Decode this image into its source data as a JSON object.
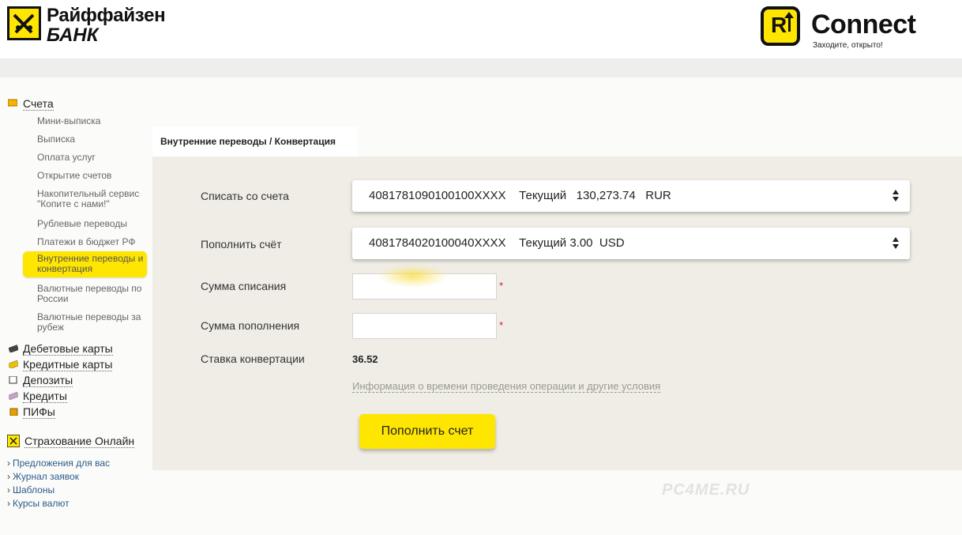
{
  "header": {
    "bank_logo_line1": "Райффайзен",
    "bank_logo_line2": "БАНК",
    "connect_letter": "R",
    "connect_title": "Connect",
    "connect_subtitle": "Заходите, открыто!"
  },
  "sidebar": {
    "accounts_title": "Счета",
    "account_items": [
      "Мини-выписка",
      "Выписка",
      "Оплата услуг",
      "Открытие счетов",
      "Накопительный сервис \"Копите с нами!\"",
      "Рублевые переводы",
      "Платежи в бюджет РФ",
      "Внутренние переводы и конвертация",
      "Валютные переводы по России",
      "Валютные переводы за рубеж"
    ],
    "products": [
      "Дебетовые карты",
      "Кредитные карты",
      "Депозиты",
      "Кредиты",
      "ПИФы"
    ],
    "insurance": "Страхование Онлайн",
    "links": [
      "Предложения для вас",
      "Журнал заявок",
      "Шаблоны",
      "Курсы валют"
    ]
  },
  "main": {
    "tab_label": "Внутренние переводы / Конвертация",
    "debit_label": "Списать со счета",
    "debit_value": "40817810901001​00XXXX    Текущий   130,273.74   RUR",
    "credit_label": "Пополнить счёт",
    "credit_value": "4081784020100040XXXX    Текущий 3.00  USD",
    "debit_amount_label": "Сумма списания",
    "credit_amount_label": "Сумма пополнения",
    "rate_label": "Ставка конвертации",
    "rate_value": "36.52",
    "required_mark": "*",
    "info_link": "Информация о времени проведения операции и другие условия",
    "submit_label": "Пополнить счет"
  },
  "watermark": "PC4ME.RU",
  "colors": {
    "brand_yellow": "#fee600",
    "panel_bg": "#efede6",
    "link_blue": "#2b5d8a"
  }
}
